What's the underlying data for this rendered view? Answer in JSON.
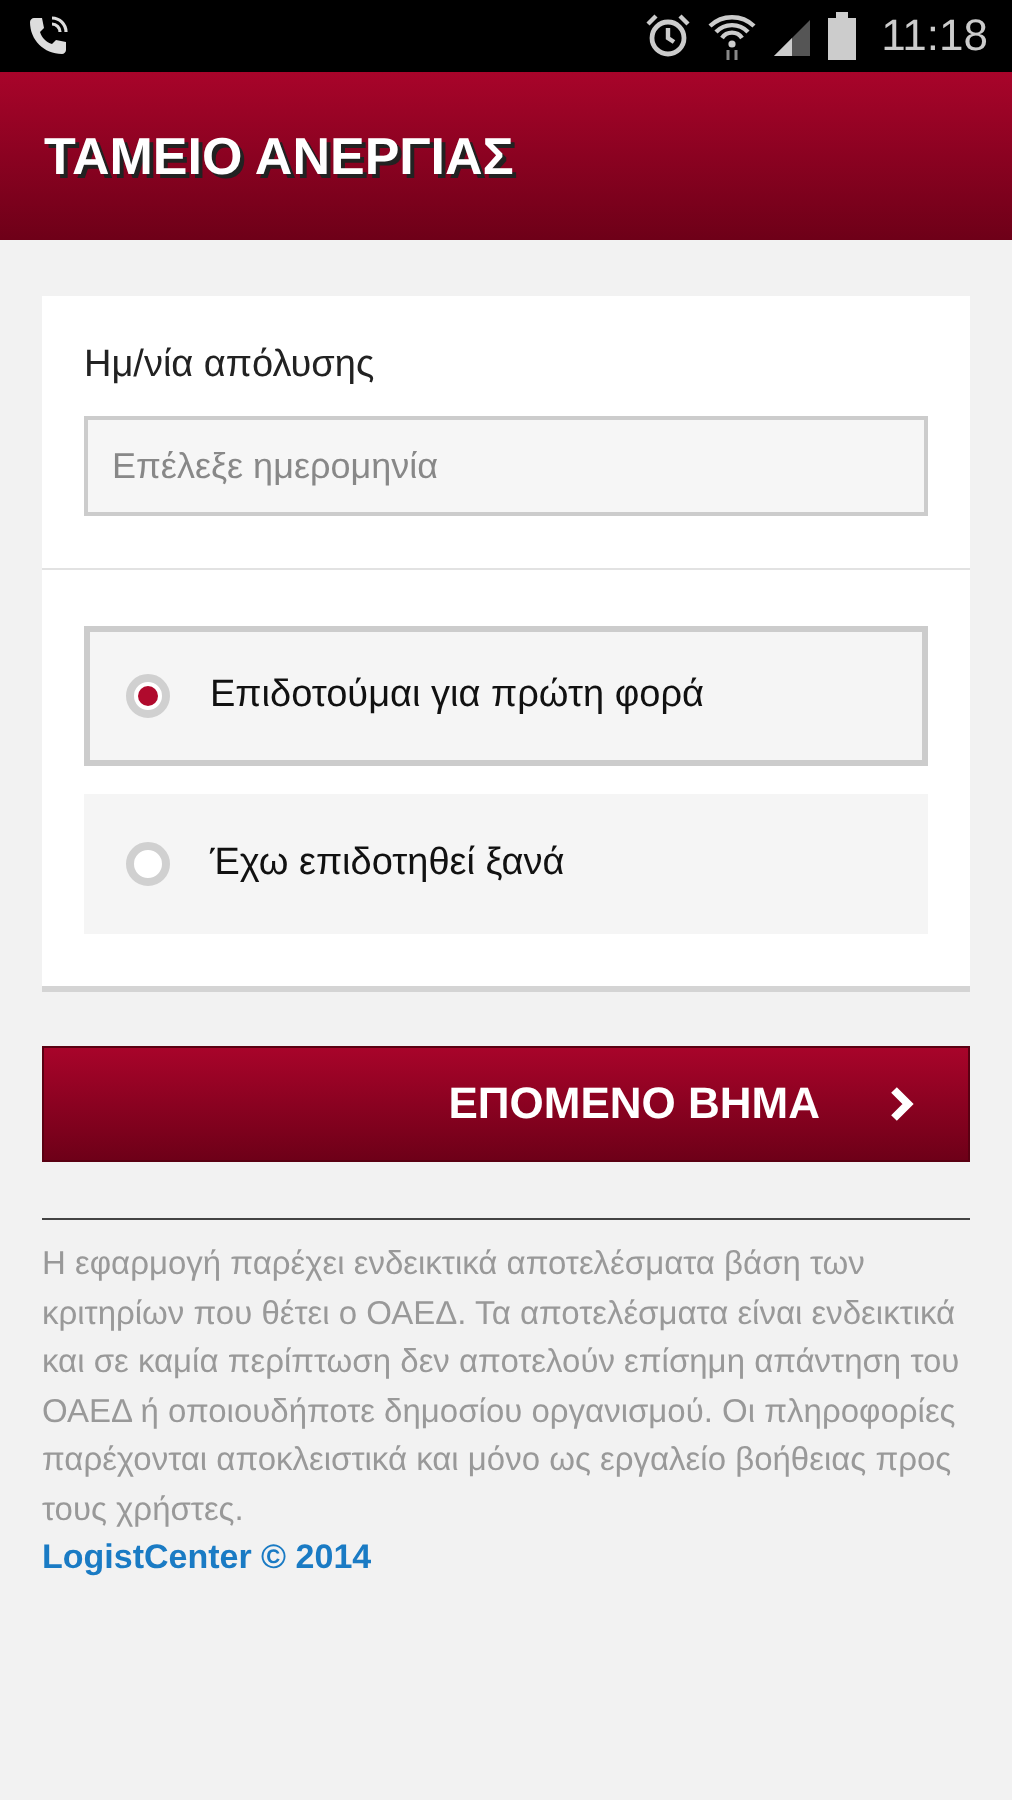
{
  "status_bar": {
    "time": "11:18"
  },
  "header": {
    "title": "ΤΑΜΕΙΟ ΑΝΕΡΓΙΑΣ"
  },
  "form": {
    "date_label": "Ημ/νία απόλυσης",
    "date_field": {
      "placeholder": "Επέλεξε ημερομηνία"
    },
    "options": [
      {
        "label": "Επιδοτούμαι για πρώτη φορά",
        "selected": true
      },
      {
        "label": "Έχω επιδοτηθεί ξανά",
        "selected": false
      }
    ]
  },
  "next_button": {
    "label": "ΕΠΟΜΕΝΟ ΒΗΜΑ"
  },
  "disclaimer": "Η εφαρμογή παρέχει ενδεικτικά αποτελέσματα βάση των κριτηρίων που θέτει ο ΟΑΕΔ. Τα αποτελέσματα είναι ενδεικτικά και σε καμία περίπτωση δεν αποτελούν επίσημη απάντηση του ΟΑΕΔ ή οποιουδήποτε δημοσίου οργανισμού. Οι πληροφορίες παρέχονται αποκλειστικά και μόνο ως εργαλείο βοήθειας προς τους χρήστες.",
  "credit": "LogistCenter © 2014"
}
